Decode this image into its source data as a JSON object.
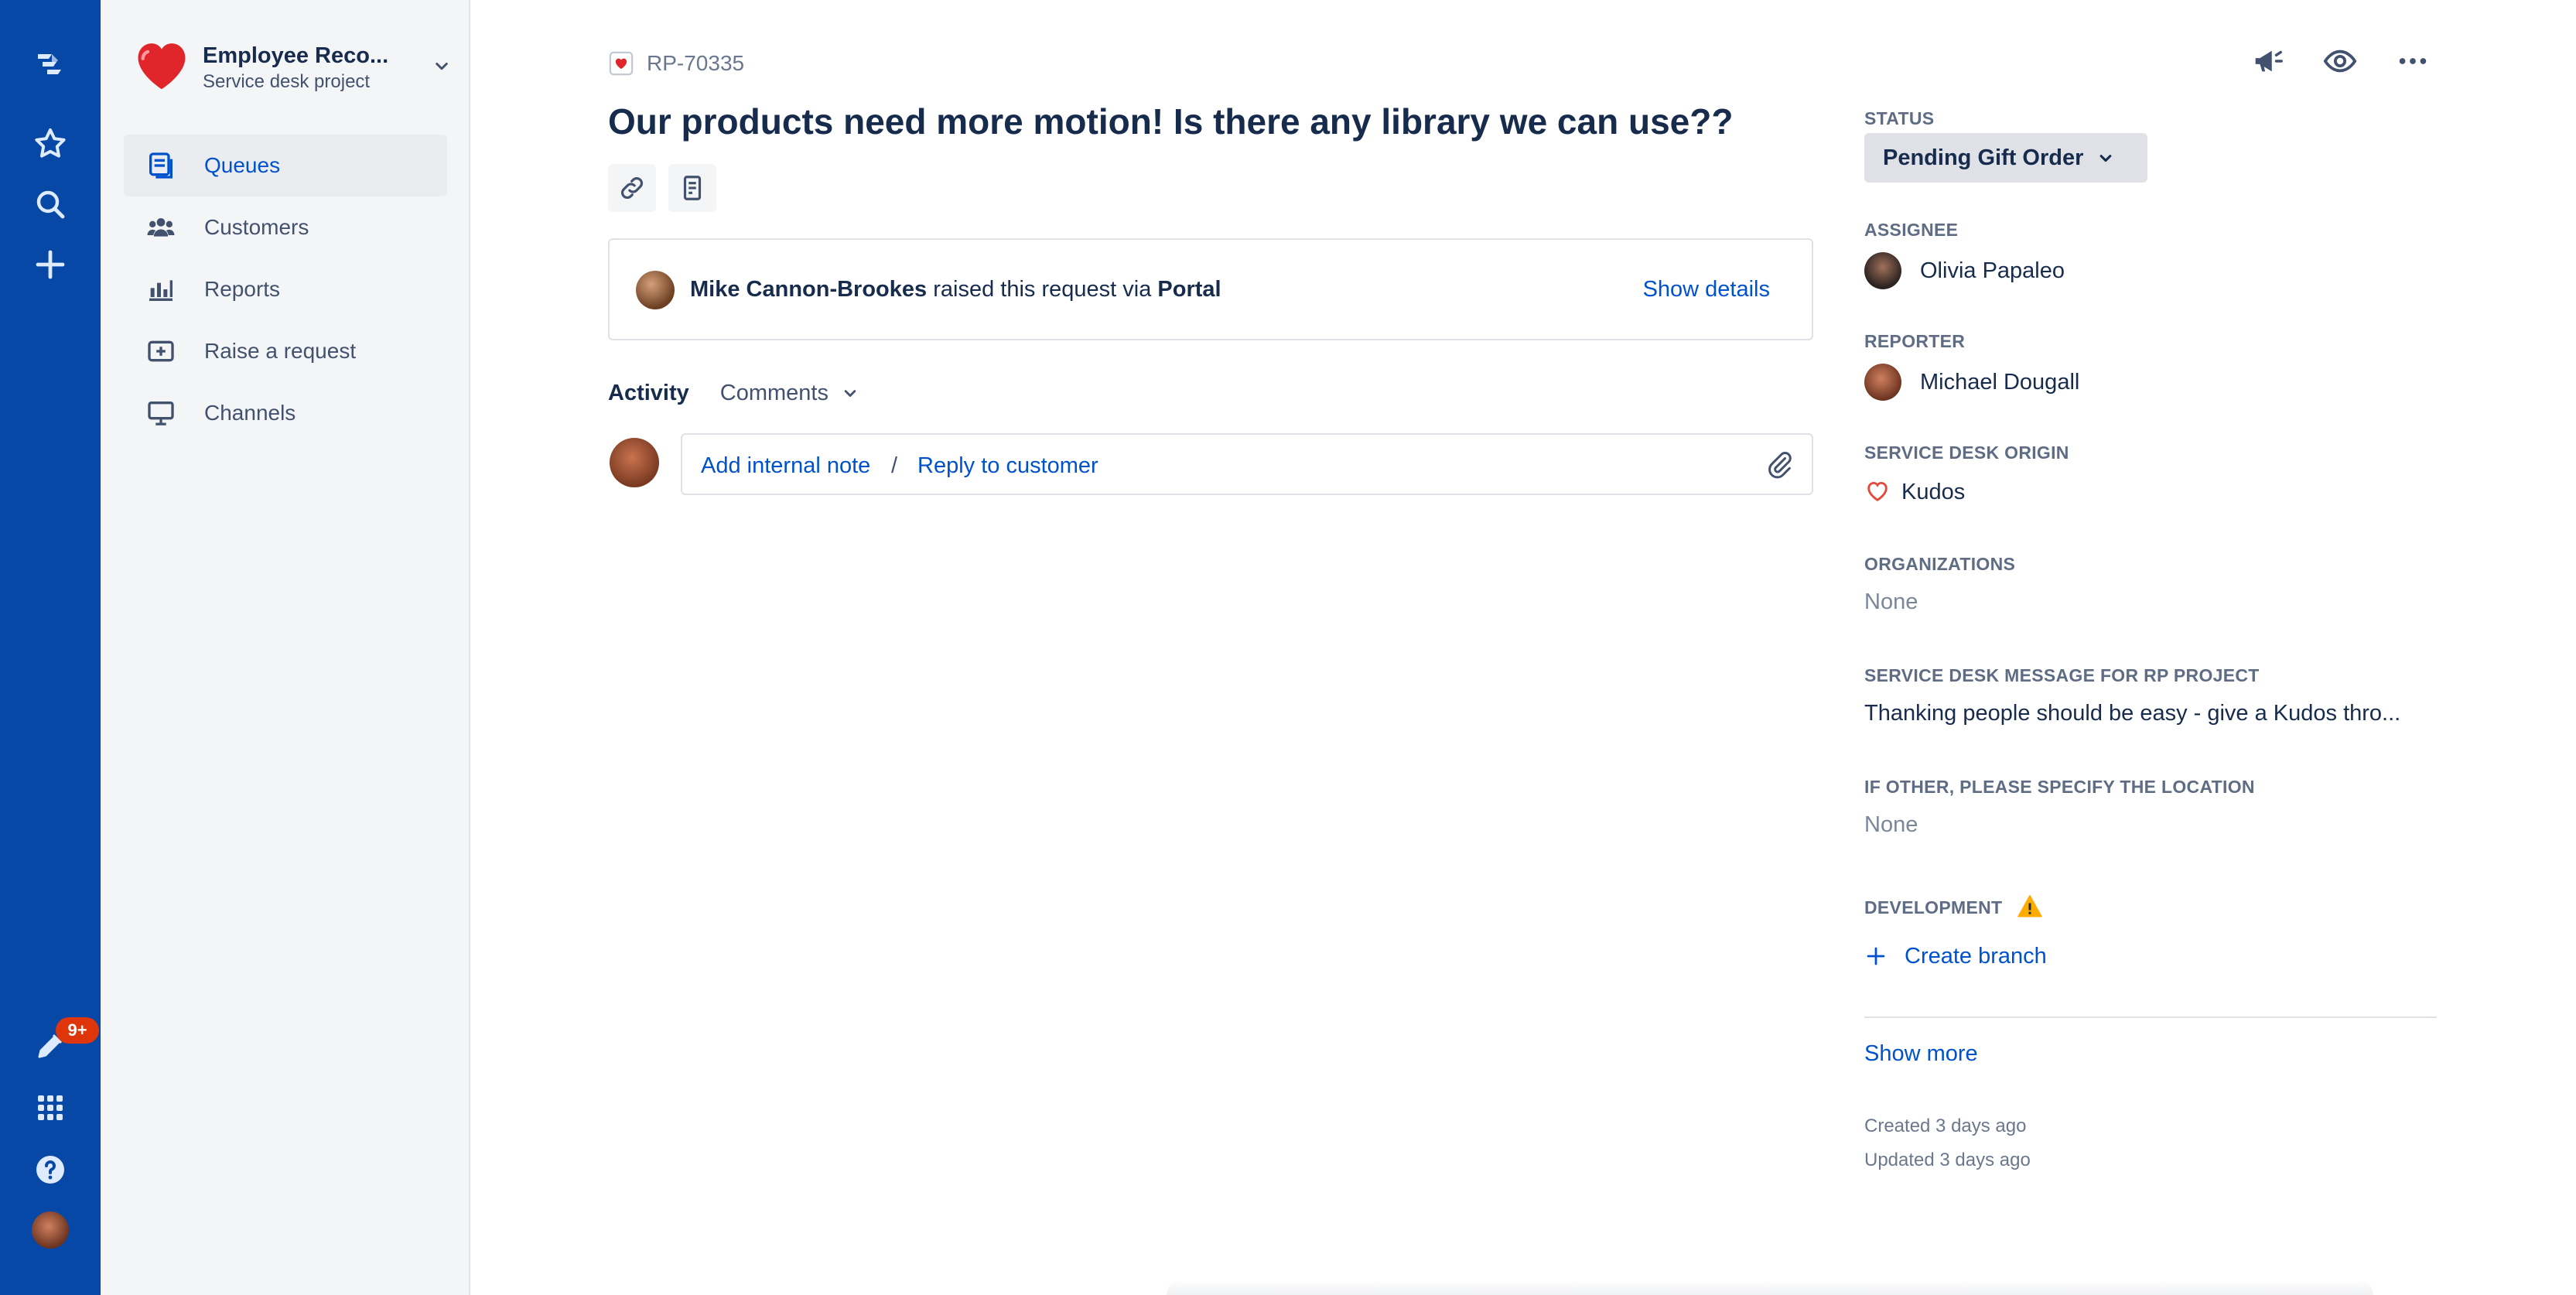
{
  "global_nav": {
    "notification_count": "9+",
    "icons": [
      "jira-logo-icon",
      "star-icon",
      "search-icon",
      "plus-icon",
      "notifications-icon",
      "app-switcher-icon",
      "help-icon",
      "profile-avatar"
    ]
  },
  "project": {
    "name": "Employee Reco...",
    "type": "Service desk project"
  },
  "sidebar": {
    "items": [
      {
        "label": "Queues",
        "icon": "queues-icon",
        "active": true
      },
      {
        "label": "Customers",
        "icon": "customers-icon",
        "active": false
      },
      {
        "label": "Reports",
        "icon": "reports-icon",
        "active": false
      },
      {
        "label": "Raise a request",
        "icon": "raise-request-icon",
        "active": false
      },
      {
        "label": "Channels",
        "icon": "channels-icon",
        "active": false
      }
    ]
  },
  "issue": {
    "key": "RP-70335",
    "title": "Our products need more motion! Is there any library we can use??",
    "request": {
      "author": "Mike Cannon-Brookes",
      "middle_text": "raised this request via",
      "channel": "Portal",
      "show_details": "Show details"
    },
    "activity": {
      "label": "Activity",
      "filter": "Comments"
    },
    "comment": {
      "internal_note": "Add internal note",
      "separator": "/",
      "reply": "Reply to customer"
    }
  },
  "details": {
    "status": {
      "label": "STATUS",
      "value": "Pending Gift Order"
    },
    "assignee": {
      "label": "ASSIGNEE",
      "value": "Olivia Papaleo"
    },
    "reporter": {
      "label": "REPORTER",
      "value": "Michael Dougall"
    },
    "origin": {
      "label": "SERVICE DESK ORIGIN",
      "value": "Kudos"
    },
    "organizations": {
      "label": "ORGANIZATIONS",
      "value": "None"
    },
    "message": {
      "label": "SERVICE DESK MESSAGE FOR RP PROJECT",
      "value": "Thanking people should be easy - give a Kudos thro..."
    },
    "location": {
      "label": "IF OTHER, PLEASE SPECIFY THE LOCATION",
      "value": "None"
    },
    "development": {
      "label": "DEVELOPMENT",
      "action": "Create branch"
    },
    "show_more": "Show more",
    "created": "Created 3 days ago",
    "updated": "Updated 3 days ago"
  },
  "colors": {
    "nav_blue": "#0747A6",
    "link_blue": "#0052CC",
    "badge_red": "#DE350B",
    "warning_yellow": "#FFAB00",
    "heart_red": "#E5493A"
  }
}
